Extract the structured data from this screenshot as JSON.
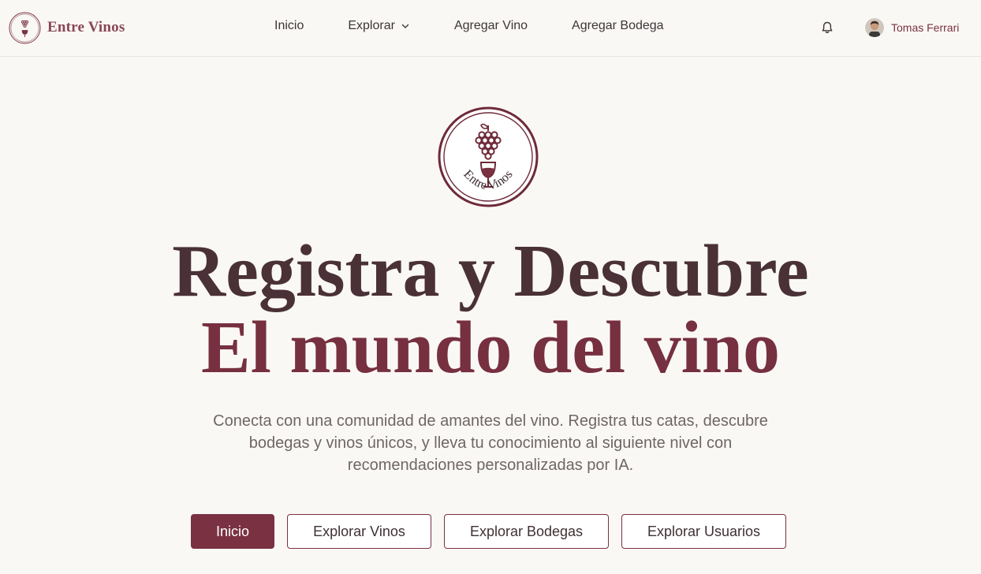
{
  "brand": {
    "name": "Entre Vinos",
    "logo_text": "Entre Vinos"
  },
  "nav": {
    "inicio": "Inicio",
    "explorar": "Explorar",
    "agregar_vino": "Agregar Vino",
    "agregar_bodega": "Agregar Bodega"
  },
  "user": {
    "name": "Tomas Ferrari"
  },
  "hero": {
    "logo_text": "Entre Vinos",
    "line1": "Registra y Descubre",
    "line2": "El mundo del vino",
    "subtitle": "Conecta con una comunidad de amantes del vino. Registra tus catas, descubre bodegas y vinos únicos, y lleva tu conocimiento al siguiente nivel con recomendaciones personalizadas por IA."
  },
  "cta": {
    "inicio": "Inicio",
    "explorar_vinos": "Explorar Vinos",
    "explorar_bodegas": "Explorar Bodegas",
    "explorar_usuarios": "Explorar Usuarios"
  },
  "colors": {
    "accent": "#7a3142",
    "background": "#faf8f5",
    "headline_dark": "#4a3137",
    "headline_wine": "#76303f"
  }
}
